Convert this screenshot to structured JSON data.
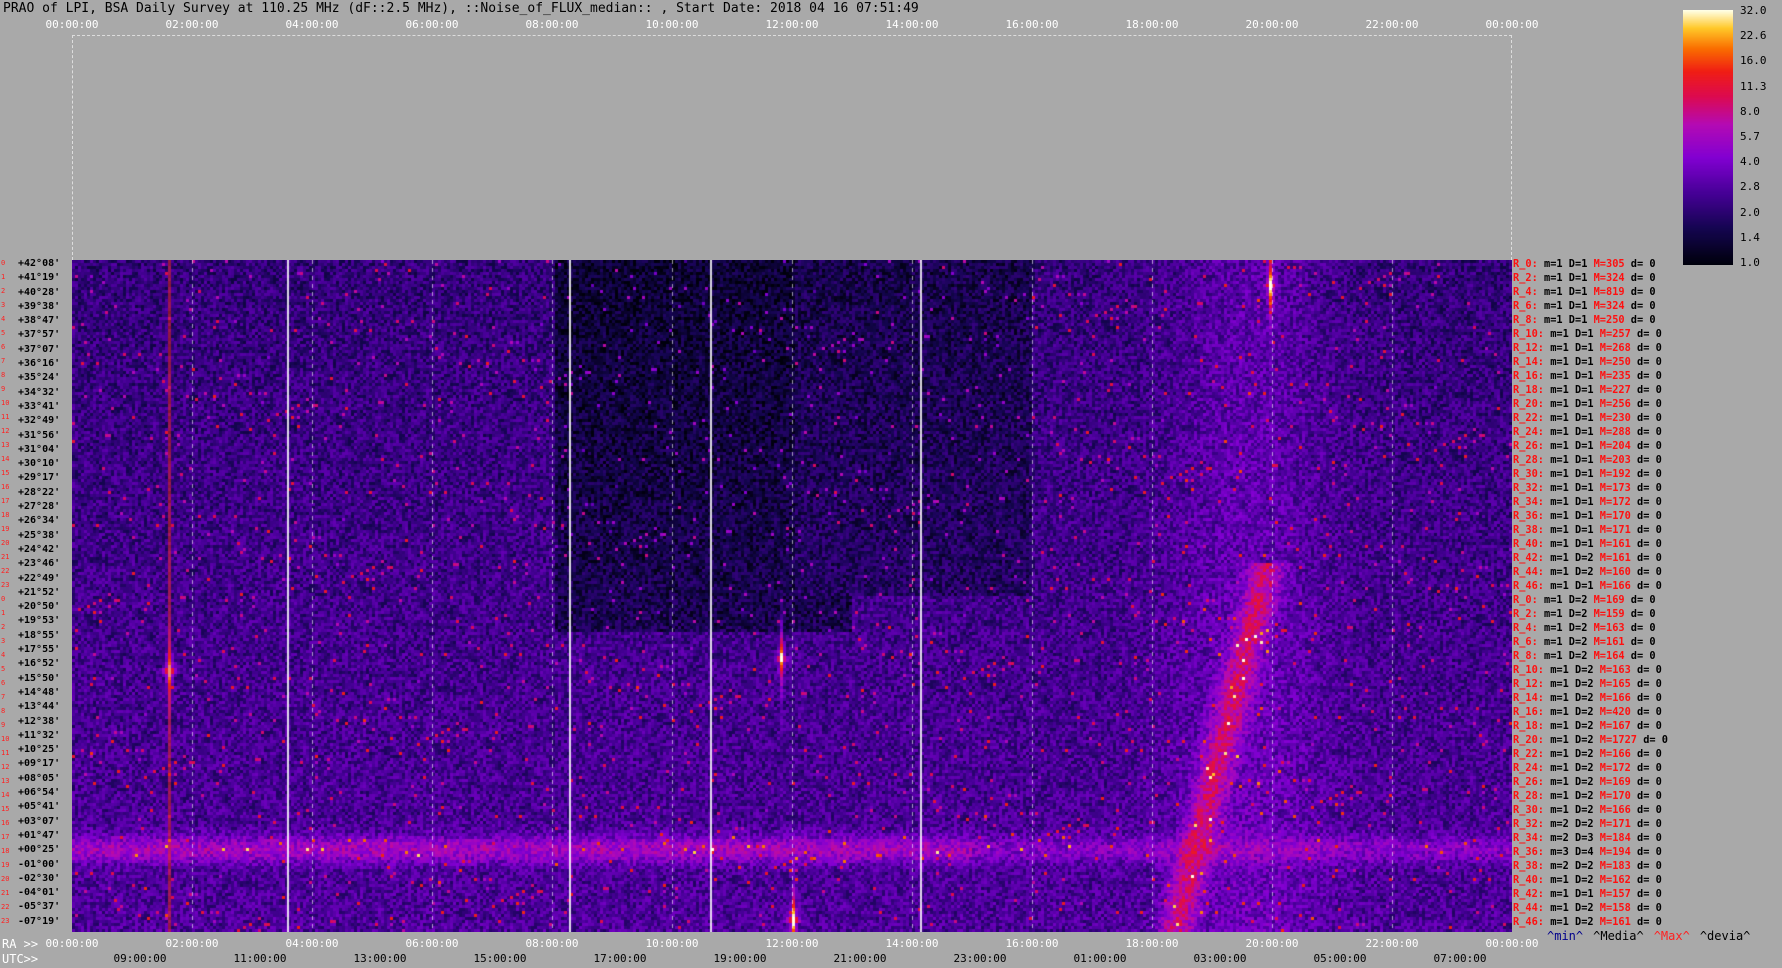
{
  "title": "PRAO of LPI, BSA Daily Survey at 110.25 MHz (dF::2.5 MHz), ::Noise_of_FLUX_median:: , Start Date: 2018 04 16 07:51:49",
  "top_ticks": [
    "00:00:00",
    "02:00:00",
    "04:00:00",
    "06:00:00",
    "08:00:00",
    "10:00:00",
    "12:00:00",
    "14:00:00",
    "16:00:00",
    "18:00:00",
    "20:00:00",
    "22:00:00",
    "00:00:00"
  ],
  "ra_prefix": "RA >>",
  "ra_ticks": [
    "00:00:00",
    "02:00:00",
    "04:00:00",
    "06:00:00",
    "08:00:00",
    "10:00:00",
    "12:00:00",
    "14:00:00",
    "16:00:00",
    "18:00:00",
    "20:00:00",
    "22:00:00",
    "00:00:00"
  ],
  "utc_prefix": "UTC>>",
  "utc_ticks": [
    "09:00:00",
    "11:00:00",
    "13:00:00",
    "15:00:00",
    "17:00:00",
    "19:00:00",
    "21:00:00",
    "23:00:00",
    "01:00:00",
    "03:00:00",
    "05:00:00",
    "07:00:00"
  ],
  "stats_labels": [
    {
      "text": "^min^",
      "color": "#00008b"
    },
    {
      "text": "^Media^",
      "color": "#000000"
    },
    {
      "text": "^Max^",
      "color": "#ff2020"
    },
    {
      "text": "^devia^",
      "color": "#000000"
    }
  ],
  "colorbar_labels": [
    "32.0",
    "22.6",
    "16.0",
    "11.3",
    "8.0",
    "5.7",
    "4.0",
    "2.8",
    "2.0",
    "1.4",
    "1.0"
  ],
  "declinations": [
    "+42°08'",
    "+41°19'",
    "+40°28'",
    "+39°38'",
    "+38°47'",
    "+37°57'",
    "+37°07'",
    "+36°16'",
    "+35°24'",
    "+34°32'",
    "+33°41'",
    "+32°49'",
    "+31°56'",
    "+31°04'",
    "+30°10'",
    "+29°17'",
    "+28°22'",
    "+27°28'",
    "+26°34'",
    "+25°38'",
    "+24°42'",
    "+23°46'",
    "+22°49'",
    "+21°52'",
    "+20°50'",
    "+19°53'",
    "+18°55'",
    "+17°55'",
    "+16°52'",
    "+15°50'",
    "+14°48'",
    "+13°44'",
    "+12°38'",
    "+11°32'",
    "+10°25'",
    "+09°17'",
    "+08°05'",
    "+06°54'",
    "+05°41'",
    "+03°07'",
    "+01°47'",
    "+00°25'",
    "-01°00'",
    "-02°30'",
    "-04°01'",
    "-05°37'",
    "-07°19'"
  ],
  "row_labels": [
    {
      "r": "R_0:",
      "m": "m=1",
      "d": "D=1",
      "M": "M=305",
      "dev": "d= 0"
    },
    {
      "r": "R_2:",
      "m": "m=1",
      "d": "D=1",
      "M": "M=324",
      "dev": "d= 0"
    },
    {
      "r": "R_4:",
      "m": "m=1",
      "d": "D=1",
      "M": "M=819",
      "dev": "d= 0"
    },
    {
      "r": "R_6:",
      "m": "m=1",
      "d": "D=1",
      "M": "M=324",
      "dev": "d= 0"
    },
    {
      "r": "R_8:",
      "m": "m=1",
      "d": "D=1",
      "M": "M=250",
      "dev": "d= 0"
    },
    {
      "r": "R_10:",
      "m": "m=1",
      "d": "D=1",
      "M": "M=257",
      "dev": "d= 0"
    },
    {
      "r": "R_12:",
      "m": "m=1",
      "d": "D=1",
      "M": "M=268",
      "dev": "d= 0"
    },
    {
      "r": "R_14:",
      "m": "m=1",
      "d": "D=1",
      "M": "M=250",
      "dev": "d= 0"
    },
    {
      "r": "R_16:",
      "m": "m=1",
      "d": "D=1",
      "M": "M=235",
      "dev": "d= 0"
    },
    {
      "r": "R_18:",
      "m": "m=1",
      "d": "D=1",
      "M": "M=227",
      "dev": "d= 0"
    },
    {
      "r": "R_20:",
      "m": "m=1",
      "d": "D=1",
      "M": "M=256",
      "dev": "d= 0"
    },
    {
      "r": "R_22:",
      "m": "m=1",
      "d": "D=1",
      "M": "M=230",
      "dev": "d= 0"
    },
    {
      "r": "R_24:",
      "m": "m=1",
      "d": "D=1",
      "M": "M=288",
      "dev": "d= 0"
    },
    {
      "r": "R_26:",
      "m": "m=1",
      "d": "D=1",
      "M": "M=204",
      "dev": "d= 0"
    },
    {
      "r": "R_28:",
      "m": "m=1",
      "d": "D=1",
      "M": "M=203",
      "dev": "d= 0"
    },
    {
      "r": "R_30:",
      "m": "m=1",
      "d": "D=1",
      "M": "M=192",
      "dev": "d= 0"
    },
    {
      "r": "R_32:",
      "m": "m=1",
      "d": "D=1",
      "M": "M=173",
      "dev": "d= 0"
    },
    {
      "r": "R_34:",
      "m": "m=1",
      "d": "D=1",
      "M": "M=172",
      "dev": "d= 0"
    },
    {
      "r": "R_36:",
      "m": "m=1",
      "d": "D=1",
      "M": "M=170",
      "dev": "d= 0"
    },
    {
      "r": "R_38:",
      "m": "m=1",
      "d": "D=1",
      "M": "M=171",
      "dev": "d= 0"
    },
    {
      "r": "R_40:",
      "m": "m=1",
      "d": "D=1",
      "M": "M=161",
      "dev": "d= 0"
    },
    {
      "r": "R_42:",
      "m": "m=1",
      "d": "D=2",
      "M": "M=161",
      "dev": "d= 0"
    },
    {
      "r": "R_44:",
      "m": "m=1",
      "d": "D=2",
      "M": "M=160",
      "dev": "d= 0"
    },
    {
      "r": "R_46:",
      "m": "m=1",
      "d": "D=1",
      "M": "M=166",
      "dev": "d= 0"
    },
    {
      "r": "R_0:",
      "m": "m=1",
      "d": "D=2",
      "M": "M=169",
      "dev": "d= 0"
    },
    {
      "r": "R_2:",
      "m": "m=1",
      "d": "D=2",
      "M": "M=159",
      "dev": "d= 0"
    },
    {
      "r": "R_4:",
      "m": "m=1",
      "d": "D=2",
      "M": "M=163",
      "dev": "d= 0"
    },
    {
      "r": "R_6:",
      "m": "m=1",
      "d": "D=2",
      "M": "M=161",
      "dev": "d= 0"
    },
    {
      "r": "R_8:",
      "m": "m=1",
      "d": "D=2",
      "M": "M=164",
      "dev": "d= 0"
    },
    {
      "r": "R_10:",
      "m": "m=1",
      "d": "D=2",
      "M": "M=163",
      "dev": "d= 0"
    },
    {
      "r": "R_12:",
      "m": "m=1",
      "d": "D=2",
      "M": "M=165",
      "dev": "d= 0"
    },
    {
      "r": "R_14:",
      "m": "m=1",
      "d": "D=2",
      "M": "M=166",
      "dev": "d= 0"
    },
    {
      "r": "R_16:",
      "m": "m=1",
      "d": "D=2",
      "M": "M=420",
      "dev": "d= 0"
    },
    {
      "r": "R_18:",
      "m": "m=1",
      "d": "D=2",
      "M": "M=167",
      "dev": "d= 0"
    },
    {
      "r": "R_20:",
      "m": "m=1",
      "d": "D=2",
      "M": "M=1727",
      "dev": "d= 0"
    },
    {
      "r": "R_22:",
      "m": "m=1",
      "d": "D=2",
      "M": "M=166",
      "dev": "d= 0"
    },
    {
      "r": "R_24:",
      "m": "m=1",
      "d": "D=2",
      "M": "M=172",
      "dev": "d= 0"
    },
    {
      "r": "R_26:",
      "m": "m=1",
      "d": "D=2",
      "M": "M=169",
      "dev": "d= 0"
    },
    {
      "r": "R_28:",
      "m": "m=1",
      "d": "D=2",
      "M": "M=170",
      "dev": "d= 0"
    },
    {
      "r": "R_30:",
      "m": "m=1",
      "d": "D=2",
      "M": "M=166",
      "dev": "d= 0"
    },
    {
      "r": "R_32:",
      "m": "m=2",
      "d": "D=2",
      "M": "M=171",
      "dev": "d= 0"
    },
    {
      "r": "R_34:",
      "m": "m=2",
      "d": "D=3",
      "M": "M=184",
      "dev": "d= 0"
    },
    {
      "r": "R_36:",
      "m": "m=3",
      "d": "D=4",
      "M": "M=194",
      "dev": "d= 0"
    },
    {
      "r": "R_38:",
      "m": "m=2",
      "d": "D=2",
      "M": "M=183",
      "dev": "d= 0"
    },
    {
      "r": "R_40:",
      "m": "m=1",
      "d": "D=2",
      "M": "M=162",
      "dev": "d= 0"
    },
    {
      "r": "R_42:",
      "m": "m=1",
      "d": "D=1",
      "M": "M=157",
      "dev": "d= 0"
    },
    {
      "r": "R_44:",
      "m": "m=1",
      "d": "D=2",
      "M": "M=158",
      "dev": "d= 0"
    },
    {
      "r": "R_46:",
      "m": "m=1",
      "d": "D=2",
      "M": "M=161",
      "dev": "d= 0"
    }
  ],
  "chart_data": {
    "type": "heatmap",
    "title": "PRAO of LPI, BSA Daily Survey at 110.25 MHz (dF::2.5 MHz), ::Noise_of_FLUX_median:: , Start Date: 2018 04 16 07:51:49",
    "x_axis_top": "RA 00:00:00 to 00:00:00",
    "x_axis_bottom_ra": [
      "00:00:00",
      "02:00:00",
      "04:00:00",
      "06:00:00",
      "08:00:00",
      "10:00:00",
      "12:00:00",
      "14:00:00",
      "16:00:00",
      "18:00:00",
      "20:00:00",
      "22:00:00",
      "00:00:00"
    ],
    "x_axis_bottom_utc": [
      "09:00:00",
      "11:00:00",
      "13:00:00",
      "15:00:00",
      "17:00:00",
      "19:00:00",
      "21:00:00",
      "23:00:00",
      "01:00:00",
      "03:00:00",
      "05:00:00",
      "07:00:00"
    ],
    "colorscale": {
      "min": 1.0,
      "max": 32.0,
      "ticks": [
        1.0,
        1.4,
        2.0,
        2.8,
        4.0,
        5.7,
        8.0,
        11.3,
        16.0,
        22.6,
        32.0
      ],
      "scale": "log"
    },
    "rows": 48,
    "notable_sources": [
      {
        "ra_h": 19.95,
        "dec": "+41°19'",
        "peak": 32
      },
      {
        "ra_h": 1.6,
        "dec": "+10°25'",
        "peak": 32
      },
      {
        "ra_h": 12.0,
        "dec": "-07°19'",
        "peak": 32
      },
      {
        "ra_h": 11.8,
        "dec": "+12°38'",
        "peak": 22.6
      }
    ],
    "bright_band_dec": "+00°25'"
  }
}
